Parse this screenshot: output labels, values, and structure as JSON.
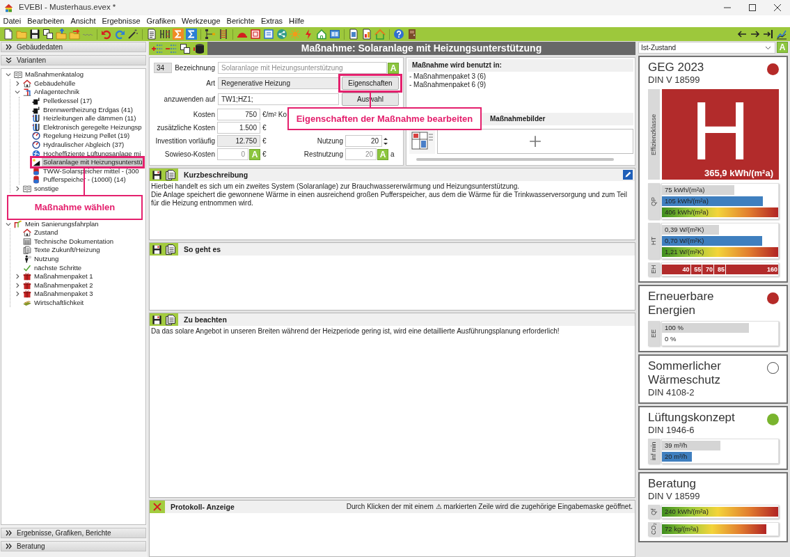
{
  "window": {
    "title": "EVEBI - Musterhaus.evex *"
  },
  "menu": [
    "Datei",
    "Bearbeiten",
    "Ansicht",
    "Ergebnisse",
    "Grafiken",
    "Werkzeuge",
    "Berichte",
    "Extras",
    "Hilfe"
  ],
  "sidebar": {
    "top_sections": [
      {
        "label": "Gebäudedaten",
        "expanded": false
      },
      {
        "label": "Varianten",
        "expanded": true
      }
    ],
    "tree": [
      {
        "label": "Maßnahmenkatalog",
        "expanded": true,
        "selected": false,
        "children": [
          {
            "label": "Gebäudehülle",
            "expanded": false,
            "selected": false
          },
          {
            "label": "Anlagentechnik",
            "expanded": true,
            "selected": false,
            "children": [
              {
                "label": "Pelletkessel (17)",
                "selected": false
              },
              {
                "label": "Brennwertheizung Erdgas (41)",
                "selected": false
              },
              {
                "label": "Heizleitungen alle dämmen (11)",
                "selected": false
              },
              {
                "label": "Elektronisch geregelte Heizungsp",
                "selected": false
              },
              {
                "label": "Regelung Heizung Pellet (19)",
                "selected": false
              },
              {
                "label": "Hydraulischer Abgleich (37)",
                "selected": false
              },
              {
                "label": "Hocheffiziente Lüftungsanlage mi",
                "selected": false
              },
              {
                "label": "Solaranlage mit Heizungsunterstü",
                "selected": true
              },
              {
                "label": "TWW-Solarspeicher mittel - (300",
                "selected": false
              },
              {
                "label": "Pufferspeicher - (1000l) (14)",
                "selected": false
              }
            ]
          },
          {
            "label": "sonstige",
            "expanded": false,
            "selected": false
          }
        ]
      },
      {
        "label": "Mein Sanierungsfahrplan",
        "expanded": true,
        "selected": false,
        "children": [
          {
            "label": "Zustand",
            "selected": false
          },
          {
            "label": "Technische Dokumentation",
            "selected": false
          },
          {
            "label": "Texte Zukunft/Heizung",
            "selected": false
          },
          {
            "label": "Nutzung",
            "selected": false
          },
          {
            "label": "nächste Schritte",
            "selected": false
          },
          {
            "label": "Maßnahmenpaket 1",
            "expanded": false,
            "selected": false
          },
          {
            "label": "Maßnahmenpaket 2",
            "expanded": false,
            "selected": false
          },
          {
            "label": "Maßnahmenpaket 3",
            "expanded": false,
            "selected": false
          },
          {
            "label": "Wirtschaftlichkeit",
            "selected": false
          }
        ]
      }
    ],
    "bottom_sections": [
      {
        "label": "Ergebnisse, Grafiken, Berichte",
        "expanded": false
      },
      {
        "label": "Beratung",
        "expanded": false
      }
    ]
  },
  "measure": {
    "title": "Maßnahme: Solaranlage mit Heizungsunterstützung",
    "number": "34",
    "name": {
      "label": "Bezeichnung",
      "value": "Solaranlage mit Heizungsunterstützung",
      "readonly": false,
      "auto_button": "A"
    },
    "type": {
      "label": "Art",
      "value": "Regenerative Heizung",
      "readonly": true,
      "button": "Eigenschaften"
    },
    "target": {
      "label": "anzuwenden auf",
      "value": "TW1;HZ1;",
      "readonly": false,
      "button": "Auswahl"
    },
    "costs": [
      {
        "label": "Kosten",
        "value": "750",
        "unit": "€/m² Ko",
        "readonly": false
      },
      {
        "label": "zusätzliche Kosten",
        "value": "1.500",
        "unit": "€",
        "readonly": false
      },
      {
        "label": "Investition vorläufig",
        "value": "12.750",
        "unit": "€",
        "readonly": true
      },
      {
        "label": "Sowieso-Kosten",
        "value": "0",
        "unit": "€",
        "readonly": false,
        "auto_button": "A"
      }
    ],
    "lifetime": [
      {
        "label": "Nutzung",
        "value": "20",
        "kind": "spin"
      },
      {
        "label": "Restnutzung",
        "value": "20",
        "unit": "a",
        "kind": "field",
        "auto_button": "A"
      }
    ],
    "used_in": {
      "title": "Maßnahme wird benutzt in:",
      "items": [
        "- Maßnahmenpaket 3 (6)",
        "- Maßnahmenpaket 6 (9)"
      ]
    },
    "images": {
      "title": "Maßnahmebilder"
    }
  },
  "sections": [
    {
      "kind": "text",
      "title": "Kurzbeschreibung",
      "editable": true,
      "lines": [
        "Hierbei handelt es sich um ein zweites System (Solaranlage) zur Brauchwassererwärmung und Heizungsunterstützung.",
        "Die Anlage speichert die gewonnene Wärme in einen ausreichend großen Pufferspeicher, aus dem die Wärme für die Trinkwasserversorgung und zum Teil für die Heizung entnommen wird."
      ]
    },
    {
      "kind": "text",
      "title": "So geht es",
      "editable": false
    },
    {
      "kind": "text",
      "title": "Zu beachten",
      "editable": false,
      "lines": [
        "Da das solare Angebot in unseren Breiten während der Heizperiode gering ist, wird eine detaillierte Ausführungsplanung erforderlich!"
      ]
    },
    {
      "kind": "log",
      "title": "Protokoll- Anzeige",
      "hint": "Durch Klicken der mit einem ⚠ markierten Zeile wird die zugehörige Eingabemaske geöffnet."
    }
  ],
  "results": {
    "variant": {
      "value": "Ist-Zustand",
      "auto_button": "A"
    },
    "cards": [
      {
        "title": "GEG 2023",
        "subtitle": "DIN V 18599",
        "indicator": {
          "filled": true,
          "color": "#b52a28"
        },
        "efficiency": {
          "axis_label": "Effizienzklasse",
          "class": "H",
          "value": "365,9 kWh/(m²a)"
        },
        "groups": [
          {
            "axis_label": "QP",
            "bars": [
              {
                "label": "75 kWh/(m²a)",
                "kind": "reference",
                "level": 0.62
              },
              {
                "label": "105 kWh/(m²a)",
                "kind": "actual",
                "level": 0.87
              },
              {
                "label": "406 kWh/(m²a)",
                "kind": "scale",
                "level": 1
              }
            ]
          },
          {
            "axis_label": "HT",
            "bars": [
              {
                "label": "0,39 W/(m²K)",
                "kind": "reference",
                "level": 0.49
              },
              {
                "label": "0,70 W/(m²K)",
                "kind": "actual",
                "level": 0.86
              },
              {
                "label": "1,21 W/(m²K)",
                "kind": "scale",
                "level": 1
              }
            ]
          }
        ],
        "scale": {
          "axis_label": "EH",
          "segments": [
            {
              "label": "40"
            },
            {
              "label": "55"
            },
            {
              "label": "70"
            },
            {
              "label": "85"
            },
            {
              "label": "160"
            }
          ]
        }
      },
      {
        "title": "Erneuerbare Energien",
        "indicator": {
          "filled": true,
          "color": "#b52a28"
        },
        "groups": [
          {
            "axis_label": "EE",
            "bars": [
              {
                "label": "100 %",
                "kind": "reference",
                "level": 0.75
              },
              {
                "label": "0 %",
                "level": 0
              }
            ]
          }
        ]
      },
      {
        "title": "Sommerlicher Wärmeschutz",
        "subtitle": "DIN 4108-2",
        "indicator": {
          "filled": false
        }
      },
      {
        "title": "Lüftungskonzept",
        "subtitle": "DIN 1946-6",
        "indicator": {
          "filled": true,
          "color": "#79b42e"
        },
        "groups": [
          {
            "axis_label": "inf min",
            "bars": [
              {
                "label": "39 m³/h",
                "kind": "reference",
                "level": 0.5
              },
              {
                "label": "20 m³/h",
                "kind": "actual",
                "level": 0.26
              }
            ]
          }
        ]
      },
      {
        "title": "Beratung",
        "subtitle": "DIN V 18599",
        "groups": [
          {
            "axis_label": "Qf",
            "bars": [
              {
                "label": "240 kWh/(m²a)",
                "kind": "scale",
                "level": 1
              }
            ]
          },
          {
            "axis_label": "CO₂",
            "bars": [
              {
                "label": "72 kg/(m²a)",
                "kind": "scale",
                "level": 0.9
              }
            ]
          }
        ]
      }
    ]
  },
  "callouts": [
    {
      "text": "Maßnahme wählen"
    },
    {
      "text": "Eigenschaften der Maßnahme bearbeiten"
    }
  ]
}
